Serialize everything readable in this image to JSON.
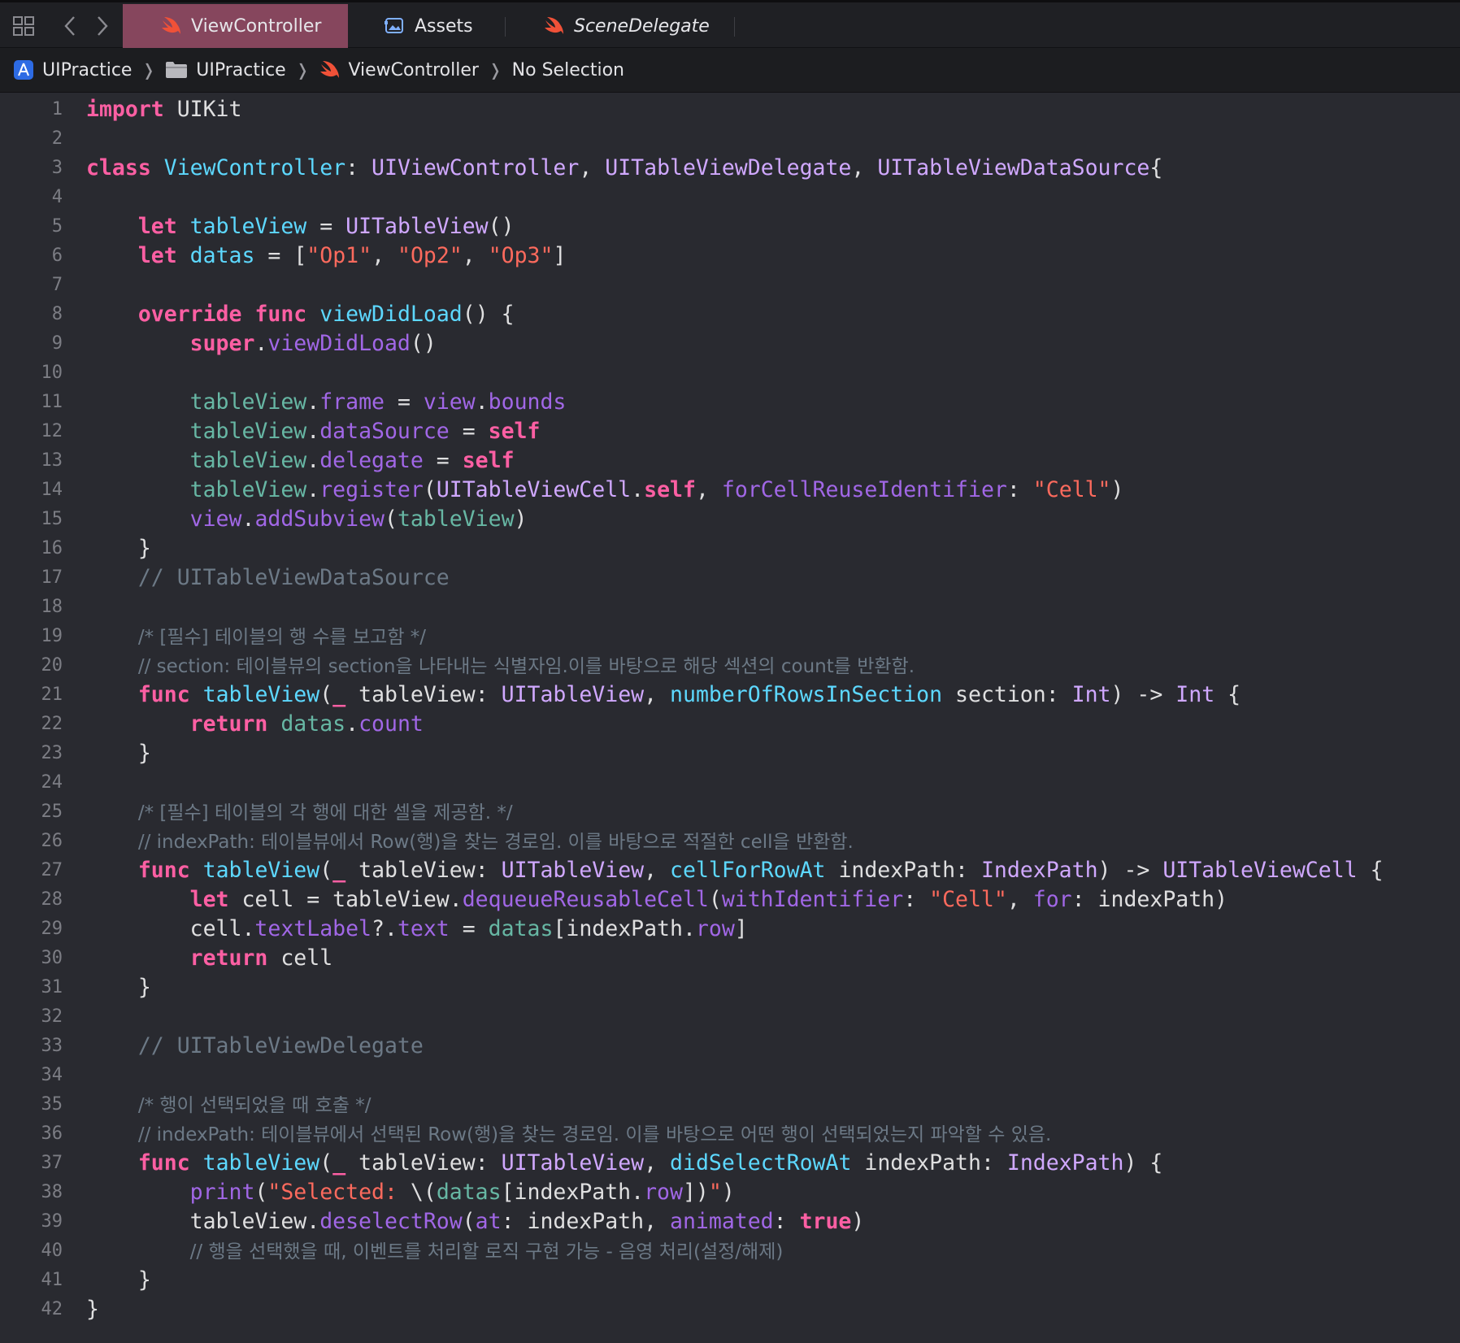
{
  "tabs": [
    {
      "label": "ViewController",
      "active": true,
      "icon": "swift-icon"
    },
    {
      "label": "Assets",
      "active": false,
      "icon": "asset-catalog-icon"
    },
    {
      "label": "SceneDelegate",
      "active": false,
      "icon": "swift-icon",
      "italic": true
    }
  ],
  "breadcrumb": [
    {
      "label": "UIPractice",
      "icon": "app-icon"
    },
    {
      "label": "UIPractice",
      "icon": "folder-icon"
    },
    {
      "label": "ViewController",
      "icon": "swift-icon"
    },
    {
      "label": "No Selection",
      "icon": null
    }
  ],
  "colors": {
    "background": "#292a30",
    "keyword": "#fc5fa3",
    "type": "#d0a8ff",
    "declaration": "#5dd8ff",
    "property": "#67b7a4",
    "function": "#a167e6",
    "string": "#fc6a5d",
    "comment": "#6c7986",
    "active_tab": "#86465d"
  },
  "code_lines": [
    [
      [
        "kw",
        "import"
      ],
      [
        "p",
        " UIKit"
      ]
    ],
    [],
    [
      [
        "kw",
        "class"
      ],
      [
        "p",
        " "
      ],
      [
        "decl",
        "ViewController"
      ],
      [
        "p",
        ": "
      ],
      [
        "ty",
        "UIViewController"
      ],
      [
        "p",
        ", "
      ],
      [
        "ty",
        "UITableViewDelegate"
      ],
      [
        "p",
        ", "
      ],
      [
        "ty",
        "UITableViewDataSource"
      ],
      [
        "p",
        "{"
      ]
    ],
    [],
    [
      [
        "p",
        "    "
      ],
      [
        "kw",
        "let"
      ],
      [
        "p",
        " "
      ],
      [
        "decl",
        "tableView"
      ],
      [
        "p",
        " = "
      ],
      [
        "ty",
        "UITableView"
      ],
      [
        "p",
        "()"
      ]
    ],
    [
      [
        "p",
        "    "
      ],
      [
        "kw",
        "let"
      ],
      [
        "p",
        " "
      ],
      [
        "decl",
        "datas"
      ],
      [
        "p",
        " = ["
      ],
      [
        "str",
        "\"Op1\""
      ],
      [
        "p",
        ", "
      ],
      [
        "str",
        "\"Op2\""
      ],
      [
        "p",
        ", "
      ],
      [
        "str",
        "\"Op3\""
      ],
      [
        "p",
        "]"
      ]
    ],
    [],
    [
      [
        "p",
        "    "
      ],
      [
        "kw",
        "override"
      ],
      [
        "p",
        " "
      ],
      [
        "kw",
        "func"
      ],
      [
        "p",
        " "
      ],
      [
        "decl",
        "viewDidLoad"
      ],
      [
        "p",
        "() {"
      ]
    ],
    [
      [
        "p",
        "        "
      ],
      [
        "kw",
        "super"
      ],
      [
        "p",
        "."
      ],
      [
        "fn",
        "viewDidLoad"
      ],
      [
        "p",
        "()"
      ]
    ],
    [],
    [
      [
        "p",
        "        "
      ],
      [
        "prop",
        "tableView"
      ],
      [
        "p",
        "."
      ],
      [
        "fn",
        "frame"
      ],
      [
        "p",
        " = "
      ],
      [
        "fn",
        "view"
      ],
      [
        "p",
        "."
      ],
      [
        "fn",
        "bounds"
      ]
    ],
    [
      [
        "p",
        "        "
      ],
      [
        "prop",
        "tableView"
      ],
      [
        "p",
        "."
      ],
      [
        "fn",
        "dataSource"
      ],
      [
        "p",
        " = "
      ],
      [
        "kw",
        "self"
      ]
    ],
    [
      [
        "p",
        "        "
      ],
      [
        "prop",
        "tableView"
      ],
      [
        "p",
        "."
      ],
      [
        "fn",
        "delegate"
      ],
      [
        "p",
        " = "
      ],
      [
        "kw",
        "self"
      ]
    ],
    [
      [
        "p",
        "        "
      ],
      [
        "prop",
        "tableView"
      ],
      [
        "p",
        "."
      ],
      [
        "fn",
        "register"
      ],
      [
        "p",
        "("
      ],
      [
        "ty",
        "UITableViewCell"
      ],
      [
        "p",
        "."
      ],
      [
        "kw",
        "self"
      ],
      [
        "p",
        ", "
      ],
      [
        "fn",
        "forCellReuseIdentifier"
      ],
      [
        "p",
        ": "
      ],
      [
        "str",
        "\"Cell\""
      ],
      [
        "p",
        ")"
      ]
    ],
    [
      [
        "p",
        "        "
      ],
      [
        "fn",
        "view"
      ],
      [
        "p",
        "."
      ],
      [
        "fn",
        "addSubview"
      ],
      [
        "p",
        "("
      ],
      [
        "prop",
        "tableView"
      ],
      [
        "p",
        ")"
      ]
    ],
    [
      [
        "p",
        "    }"
      ]
    ],
    [
      [
        "p",
        "    "
      ],
      [
        "cm",
        "// UITableViewDataSource"
      ]
    ],
    [],
    [
      [
        "p",
        "    "
      ],
      [
        "cm",
        "/* [필수] 테이블의 행 수를 보고함 */"
      ]
    ],
    [
      [
        "p",
        "    "
      ],
      [
        "cm",
        "// section: 테이블뷰의 section을 나타내는 식별자임.이를 바탕으로 해당 섹션의 count를 반환함."
      ]
    ],
    [
      [
        "p",
        "    "
      ],
      [
        "kw",
        "func"
      ],
      [
        "p",
        " "
      ],
      [
        "decl",
        "tableView"
      ],
      [
        "p",
        "("
      ],
      [
        "kw",
        "_"
      ],
      [
        "p",
        " tableView: "
      ],
      [
        "ty",
        "UITableView"
      ],
      [
        "p",
        ", "
      ],
      [
        "decl",
        "numberOfRowsInSection"
      ],
      [
        "p",
        " section: "
      ],
      [
        "ty",
        "Int"
      ],
      [
        "p",
        ") -> "
      ],
      [
        "ty",
        "Int"
      ],
      [
        "p",
        " {"
      ]
    ],
    [
      [
        "p",
        "        "
      ],
      [
        "kw",
        "return"
      ],
      [
        "p",
        " "
      ],
      [
        "prop",
        "datas"
      ],
      [
        "p",
        "."
      ],
      [
        "fn",
        "count"
      ]
    ],
    [
      [
        "p",
        "    }"
      ]
    ],
    [],
    [
      [
        "p",
        "    "
      ],
      [
        "cm",
        "/* [필수] 테이블의 각 행에 대한 셀을 제공함. */"
      ]
    ],
    [
      [
        "p",
        "    "
      ],
      [
        "cm",
        "// indexPath: 테이블뷰에서 Row(행)을 찾는 경로임. 이를 바탕으로 적절한 cell을 반환함."
      ]
    ],
    [
      [
        "p",
        "    "
      ],
      [
        "kw",
        "func"
      ],
      [
        "p",
        " "
      ],
      [
        "decl",
        "tableView"
      ],
      [
        "p",
        "("
      ],
      [
        "kw",
        "_"
      ],
      [
        "p",
        " tableView: "
      ],
      [
        "ty",
        "UITableView"
      ],
      [
        "p",
        ", "
      ],
      [
        "decl",
        "cellForRowAt"
      ],
      [
        "p",
        " indexPath: "
      ],
      [
        "ty",
        "IndexPath"
      ],
      [
        "p",
        ") -> "
      ],
      [
        "ty",
        "UITableViewCell"
      ],
      [
        "p",
        " {"
      ]
    ],
    [
      [
        "p",
        "        "
      ],
      [
        "kw",
        "let"
      ],
      [
        "p",
        " cell = tableView."
      ],
      [
        "fn",
        "dequeueReusableCell"
      ],
      [
        "p",
        "("
      ],
      [
        "fn",
        "withIdentifier"
      ],
      [
        "p",
        ": "
      ],
      [
        "str",
        "\"Cell\""
      ],
      [
        "p",
        ", "
      ],
      [
        "fn",
        "for"
      ],
      [
        "p",
        ": indexPath)"
      ]
    ],
    [
      [
        "p",
        "        cell."
      ],
      [
        "fn",
        "textLabel"
      ],
      [
        "p",
        "?."
      ],
      [
        "fn",
        "text"
      ],
      [
        "p",
        " = "
      ],
      [
        "prop",
        "datas"
      ],
      [
        "p",
        "[indexPath."
      ],
      [
        "fn",
        "row"
      ],
      [
        "p",
        "]"
      ]
    ],
    [
      [
        "p",
        "        "
      ],
      [
        "kw",
        "return"
      ],
      [
        "p",
        " cell"
      ]
    ],
    [
      [
        "p",
        "    }"
      ]
    ],
    [],
    [
      [
        "p",
        "    "
      ],
      [
        "cm",
        "// UITableViewDelegate"
      ]
    ],
    [],
    [
      [
        "p",
        "    "
      ],
      [
        "cm",
        "/* 행이 선택되었을 때 호출 */"
      ]
    ],
    [
      [
        "p",
        "    "
      ],
      [
        "cm",
        "// indexPath: 테이블뷰에서 선택된 Row(행)을 찾는 경로임. 이를 바탕으로 어떤 행이 선택되었는지 파악할 수 있음."
      ]
    ],
    [
      [
        "p",
        "    "
      ],
      [
        "kw",
        "func"
      ],
      [
        "p",
        " "
      ],
      [
        "decl",
        "tableView"
      ],
      [
        "p",
        "("
      ],
      [
        "kw",
        "_"
      ],
      [
        "p",
        " tableView: "
      ],
      [
        "ty",
        "UITableView"
      ],
      [
        "p",
        ", "
      ],
      [
        "decl",
        "didSelectRowAt"
      ],
      [
        "p",
        " indexPath: "
      ],
      [
        "ty",
        "IndexPath"
      ],
      [
        "p",
        ") {"
      ]
    ],
    [
      [
        "p",
        "        "
      ],
      [
        "fn",
        "print"
      ],
      [
        "p",
        "("
      ],
      [
        "str",
        "\"Selected: "
      ],
      [
        "p",
        "\\("
      ],
      [
        "prop",
        "datas"
      ],
      [
        "p",
        "[indexPath."
      ],
      [
        "fn",
        "row"
      ],
      [
        "p",
        "])"
      ],
      [
        "str",
        "\""
      ],
      [
        "p",
        ")"
      ]
    ],
    [
      [
        "p",
        "        tableView."
      ],
      [
        "fn",
        "deselectRow"
      ],
      [
        "p",
        "("
      ],
      [
        "fn",
        "at"
      ],
      [
        "p",
        ": indexPath, "
      ],
      [
        "fn",
        "animated"
      ],
      [
        "p",
        ": "
      ],
      [
        "kw",
        "true"
      ],
      [
        "p",
        ")"
      ]
    ],
    [
      [
        "p",
        "        "
      ],
      [
        "cm",
        "// 행을 선택했을 때, 이벤트를 처리할 로직 구현 가능 - 음영 처리(설정/해제)"
      ]
    ],
    [
      [
        "p",
        "    }"
      ]
    ],
    [
      [
        "p",
        "}"
      ]
    ]
  ]
}
